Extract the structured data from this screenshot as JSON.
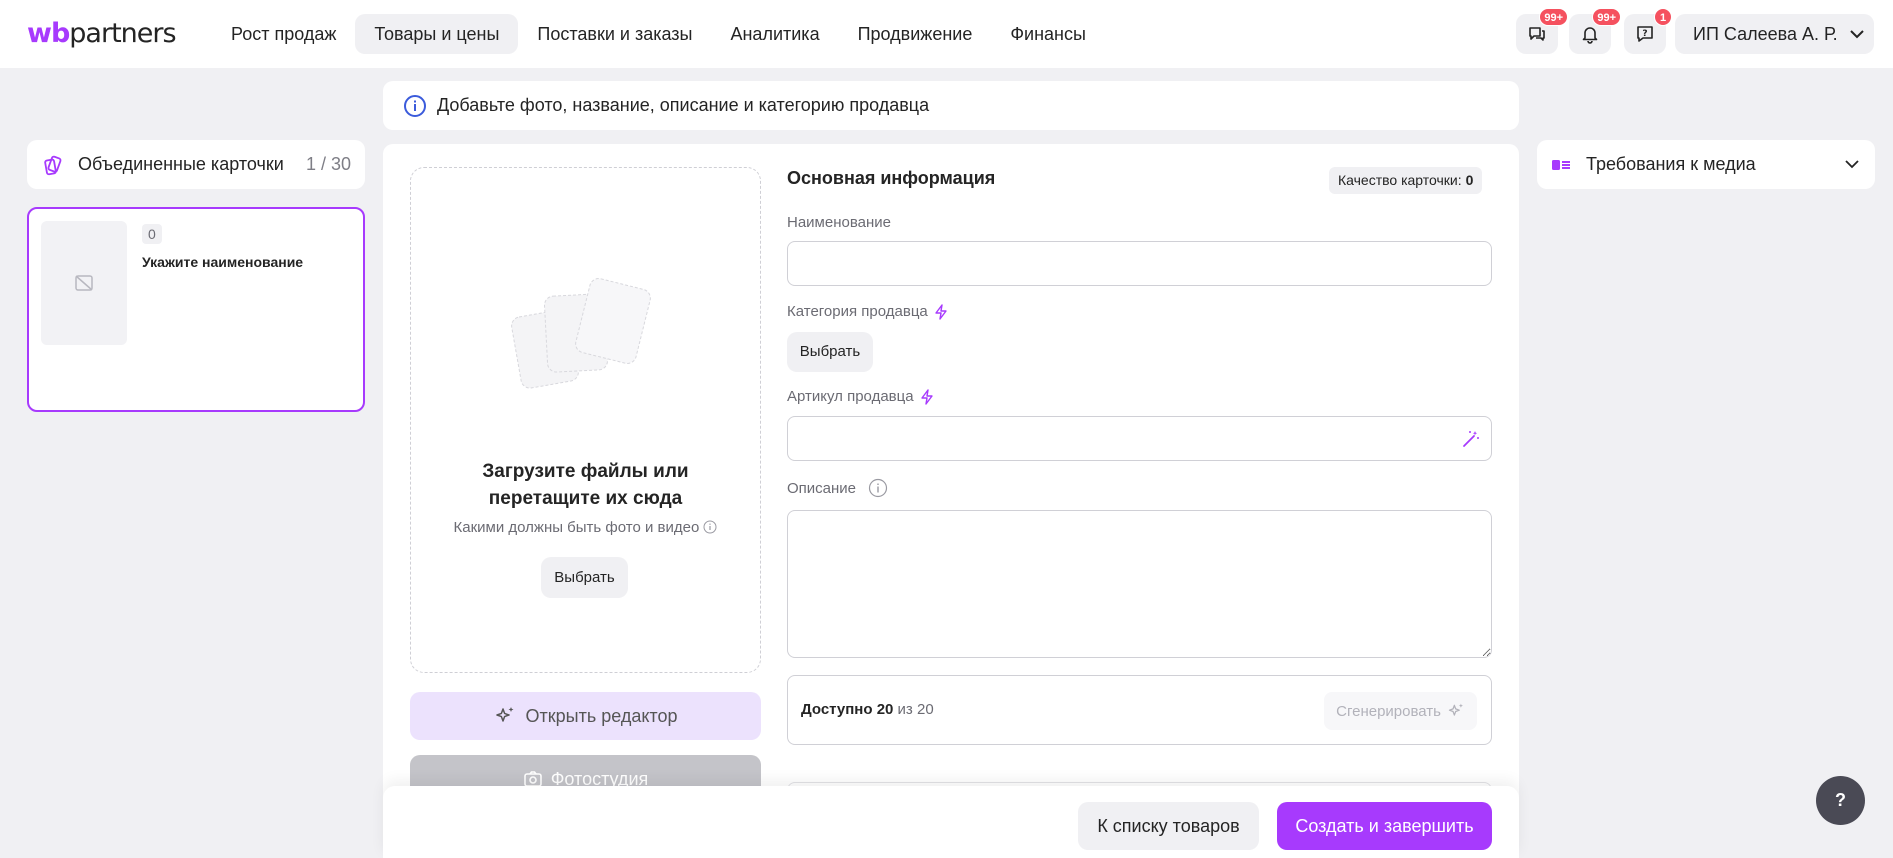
{
  "header": {
    "logo_wb": "wb",
    "logo_partners": "partners",
    "nav": [
      {
        "label": "Рост продаж",
        "active": false
      },
      {
        "label": "Товары и цены",
        "active": true
      },
      {
        "label": "Поставки и заказы",
        "active": false
      },
      {
        "label": "Аналитика",
        "active": false
      },
      {
        "label": "Продвижение",
        "active": false
      },
      {
        "label": "Финансы",
        "active": false
      }
    ],
    "chat_badge": "99+",
    "notifications_badge": "99+",
    "support_badge": "1",
    "user_name": "ИП Салеева А. Р."
  },
  "banner": {
    "text": "Добавьте фото, название, описание и категорию продавца"
  },
  "left": {
    "merged_title": "Объединенные карточки",
    "merged_count": "1 / 30",
    "card": {
      "quality": "0",
      "name": "Укажите наименование"
    }
  },
  "upload": {
    "title": "Загрузите файлы или перетащите их сюда",
    "subtitle": "Какими должны быть фото и видео",
    "choose_label": "Выбрать",
    "editor_label": "Открыть редактор",
    "studio_label": "Фотостудия"
  },
  "form": {
    "section_title": "Основная информация",
    "quality_label": "Качество карточки:",
    "quality_value": "0",
    "name_label": "Наименование",
    "name_value": "",
    "category_label": "Категория продавца",
    "category_choose": "Выбрать",
    "article_label": "Артикул продавца",
    "article_value": "",
    "description_label": "Описание",
    "description_value": "",
    "gen_available": "Доступно 20",
    "gen_of": "из 20",
    "gen_button": "Сгенерировать"
  },
  "bottom": {
    "back_label": "К списку товаров",
    "create_label": "Создать и завершить"
  },
  "right": {
    "media_title": "Требования к медиа"
  },
  "help_label": "?",
  "colors": {
    "accent": "#a73afd",
    "badge": "#f5515f",
    "background": "#f0f0f3"
  }
}
